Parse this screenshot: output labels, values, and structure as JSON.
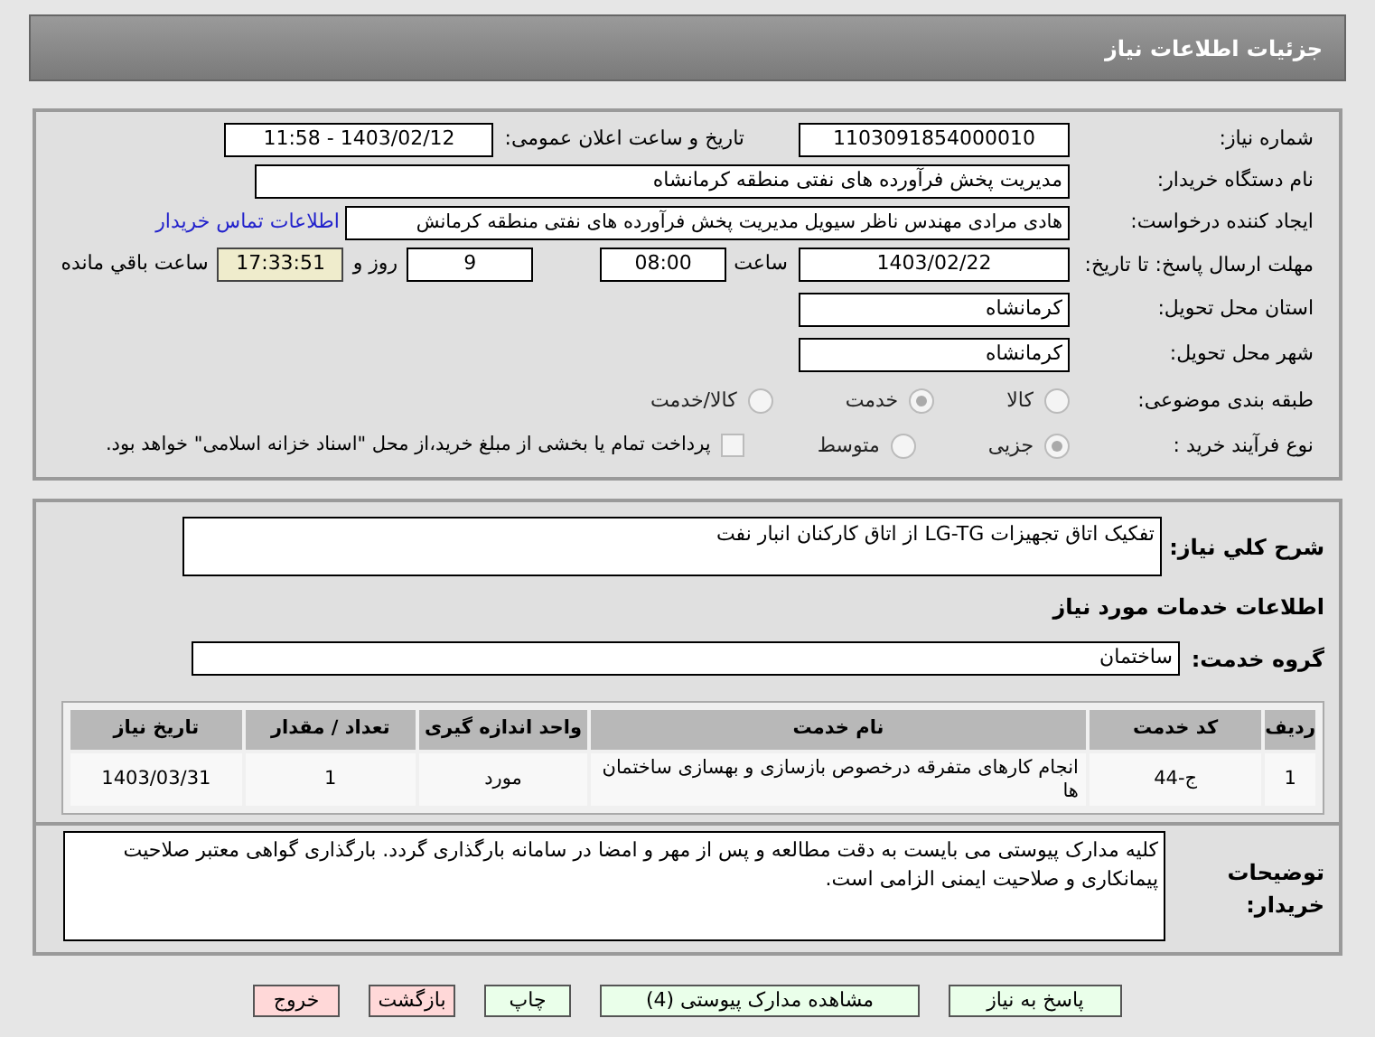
{
  "header": {
    "title": "جزئیات اطلاعات نیاز"
  },
  "details": {
    "need_number": {
      "label": "شماره نیاز:",
      "value": "1103091854000010"
    },
    "announce": {
      "label": "تاریخ و ساعت اعلان عمومی:",
      "value": "1403/02/12 - 11:58"
    },
    "buyer": {
      "label": "نام دستگاه خریدار:",
      "value": "مدیریت پخش فرآورده های نفتی منطقه کرمانشاه"
    },
    "creator": {
      "label": "ایجاد کننده درخواست:",
      "value": "هادی مرادی مهندس ناظر سیویل مدیریت پخش فرآورده های نفتی منطقه کرمانش",
      "link": "اطلاعات تماس خریدار"
    },
    "deadline": {
      "label": "مهلت ارسال پاسخ: تا تاریخ:",
      "date": "1403/02/22",
      "time_label": "ساعت",
      "time": "08:00",
      "days": "9",
      "days_label": "روز و",
      "remaining": "17:33:51",
      "remaining_label": "ساعت باقي مانده"
    },
    "province": {
      "label": "استان محل تحویل:",
      "value": "کرمانشاه"
    },
    "city": {
      "label": "شهر محل تحویل:",
      "value": "کرمانشاه"
    },
    "category": {
      "label": "طبقه بندی موضوعی:",
      "options": [
        {
          "label": "کالا",
          "selected": false
        },
        {
          "label": "خدمت",
          "selected": true
        },
        {
          "label": "کالا/خدمت",
          "selected": false
        }
      ]
    },
    "process": {
      "label": "نوع فرآیند خرید :",
      "options": [
        {
          "label": "جزیی",
          "selected": true
        },
        {
          "label": "متوسط",
          "selected": false
        }
      ],
      "payment": {
        "label": "پرداخت تمام یا بخشی از مبلغ خرید،از محل \"اسناد خزانه اسلامی\" خواهد بود.",
        "checked": false
      }
    }
  },
  "services": {
    "summary": {
      "label": "شرح کلي نیاز:",
      "value": "تفکیک اتاق تجهیزات LG-TG از اتاق کارکنان انبار نفت"
    },
    "section_title": "اطلاعات خدمات مورد نیاز",
    "group": {
      "label": "گروه خدمت:",
      "value": "ساختمان"
    },
    "table": {
      "columns": [
        "ردیف",
        "کد خدمت",
        "نام خدمت",
        "واحد اندازه گیری",
        "تعداد / مقدار",
        "تاریخ نیاز"
      ],
      "rows": [
        [
          "1",
          "ج-44",
          "انجام کارهای متفرقه درخصوص بازسازی و بهسازی ساختمان ها",
          "مورد",
          "1",
          "1403/03/31"
        ]
      ]
    }
  },
  "notes": {
    "label": "توضیحات خریدار:",
    "value": "کلیه مدارک پیوستی می بایست به دقت مطالعه و پس از مهر و امضا در سامانه بارگذاری گردد. بارگذاری گواهی معتبر صلاحیت پیمانکاری و صلاحیت ایمنی الزامی است."
  },
  "buttons": [
    {
      "label": "پاسخ به نیاز",
      "kind": "primary"
    },
    {
      "label": "مشاهده مدارک پیوستی (4)",
      "kind": "primary"
    },
    {
      "label": "چاپ",
      "kind": "primary"
    },
    {
      "label": "بازگشت",
      "kind": "danger"
    },
    {
      "label": "خروج",
      "kind": "danger"
    }
  ]
}
